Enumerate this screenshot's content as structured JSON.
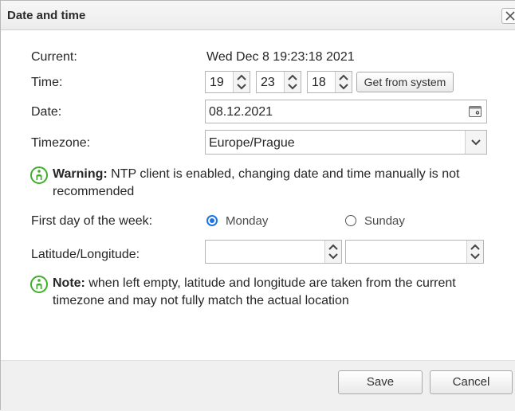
{
  "dialog": {
    "title": "Date and time"
  },
  "labels": {
    "current": "Current:",
    "time": "Time:",
    "date": "Date:",
    "timezone": "Timezone:",
    "first_day": "First day of the week:",
    "latlong": "Latitude/Longitude:"
  },
  "current_value": "Wed Dec 8 19:23:18 2021",
  "time": {
    "hours": "19",
    "minutes": "23",
    "seconds": "18",
    "get_system_label": "Get from system"
  },
  "date": {
    "value": "08.12.2021"
  },
  "timezone": {
    "value": "Europe/Prague"
  },
  "warning": {
    "bold": "Warning:",
    "line1": " NTP client is enabled, changing date and time manually is not",
    "line2": "recommended"
  },
  "first_day": {
    "options": [
      {
        "label": "Monday",
        "selected": true
      },
      {
        "label": "Sunday",
        "selected": false
      }
    ]
  },
  "latlong": {
    "latitude": "",
    "longitude": ""
  },
  "note": {
    "bold": "Note:",
    "line1": " when left empty, latitude and longitude are taken from the current",
    "line2": "timezone and may not fully match the actual location"
  },
  "footer": {
    "save_label": "Save",
    "cancel_label": "Cancel"
  },
  "colors": {
    "accent": "#1a73e8",
    "info_icon": "#3fae2a"
  }
}
